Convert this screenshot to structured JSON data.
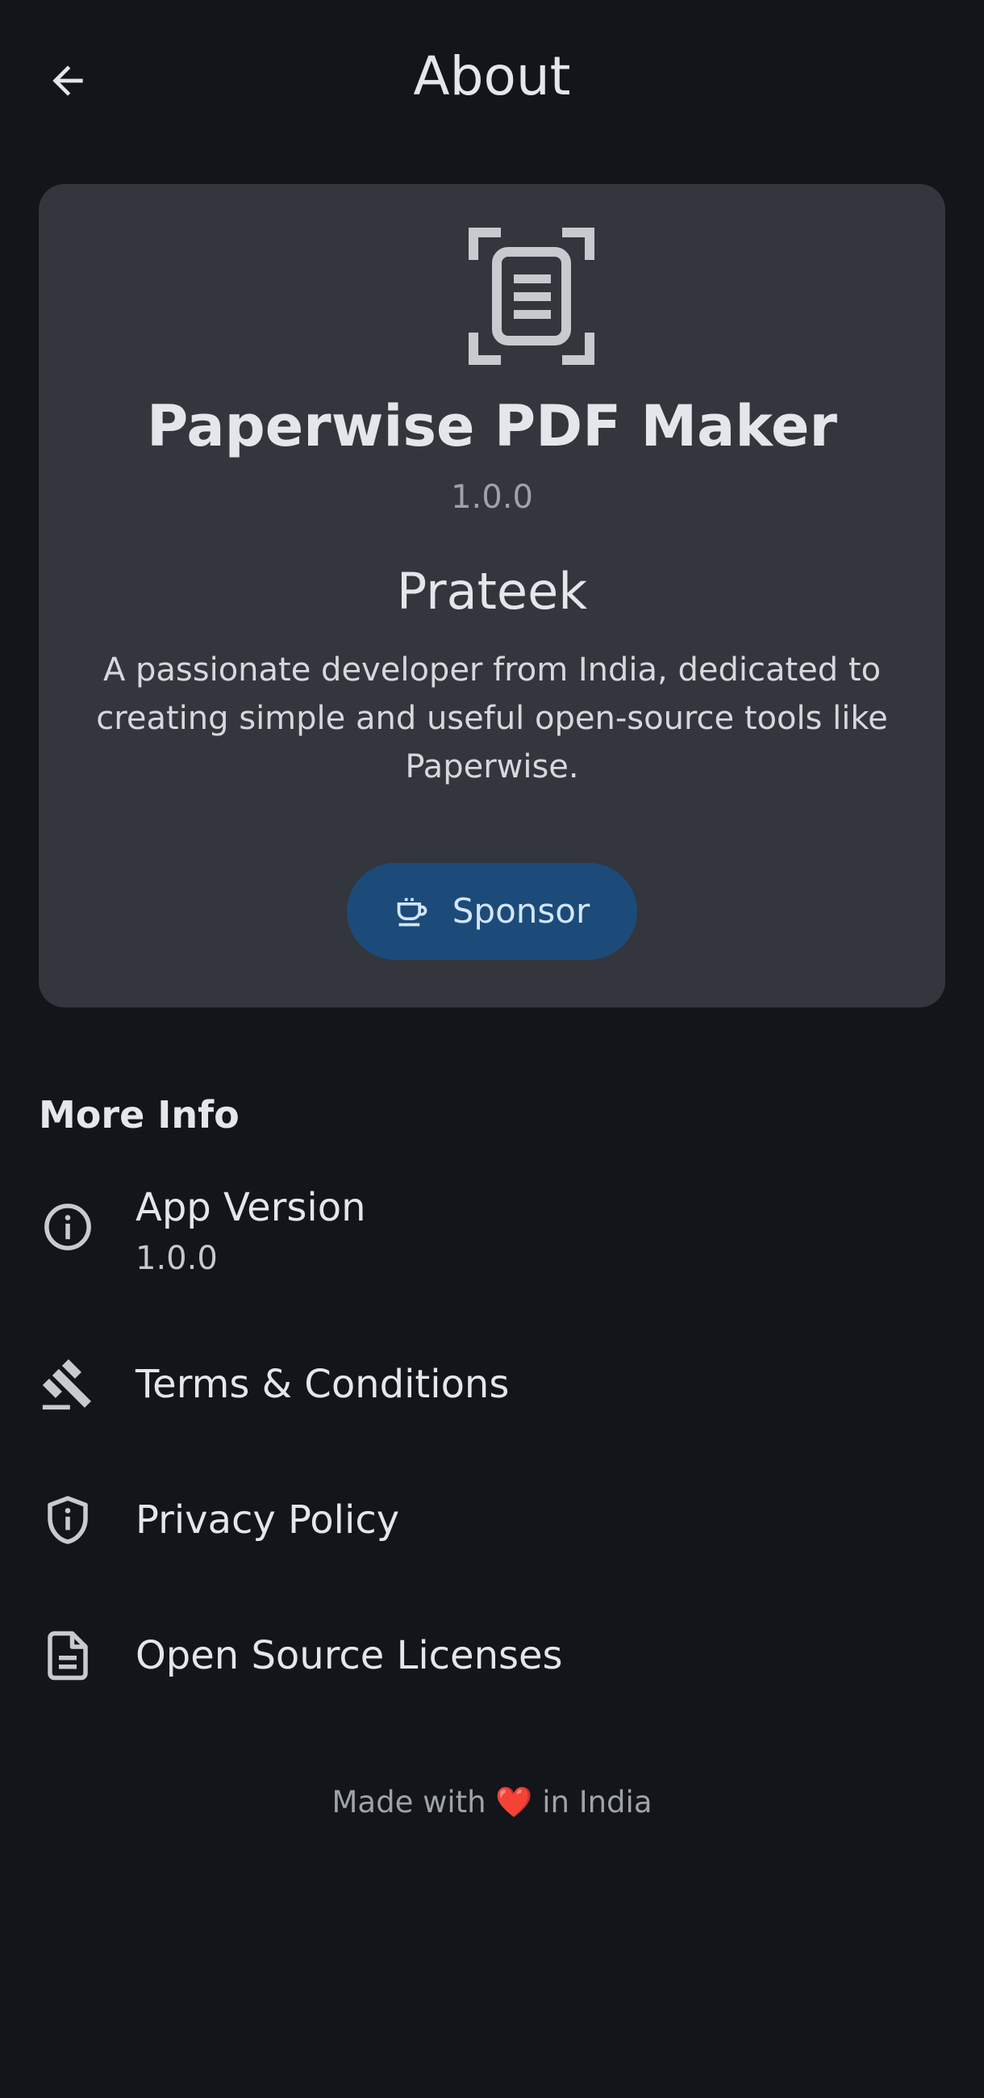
{
  "header": {
    "title": "About",
    "back_icon": "arrow-back-icon"
  },
  "card": {
    "logo_icon": "document-scanner-icon",
    "app_name": "Paperwise PDF Maker",
    "app_version": "1.0.0",
    "developer": "Prateek",
    "bio": "A passionate developer from  India, dedicated to\ncreating simple and useful open-source tools like\nPaperwise.",
    "sponsor_label": "Sponsor",
    "sponsor_icon": "coffee-cup-icon"
  },
  "more_info": {
    "title": "More Info",
    "items": [
      {
        "icon": "info-icon",
        "label": "App Version",
        "sub": "1.0.0"
      },
      {
        "icon": "gavel-icon",
        "label": "Terms & Conditions"
      },
      {
        "icon": "shield-icon",
        "label": "Privacy Policy"
      },
      {
        "icon": "document-icon",
        "label": "Open Source Licenses"
      }
    ]
  },
  "footer": {
    "prefix": "Made with",
    "heart": "❤️",
    "suffix": "in India"
  },
  "colors": {
    "background": "#121519",
    "card": "#33363C",
    "sponsor_button": "#1C4B7A",
    "text_primary": "#E4E6EC",
    "text_secondary": "#9EA2AA"
  }
}
